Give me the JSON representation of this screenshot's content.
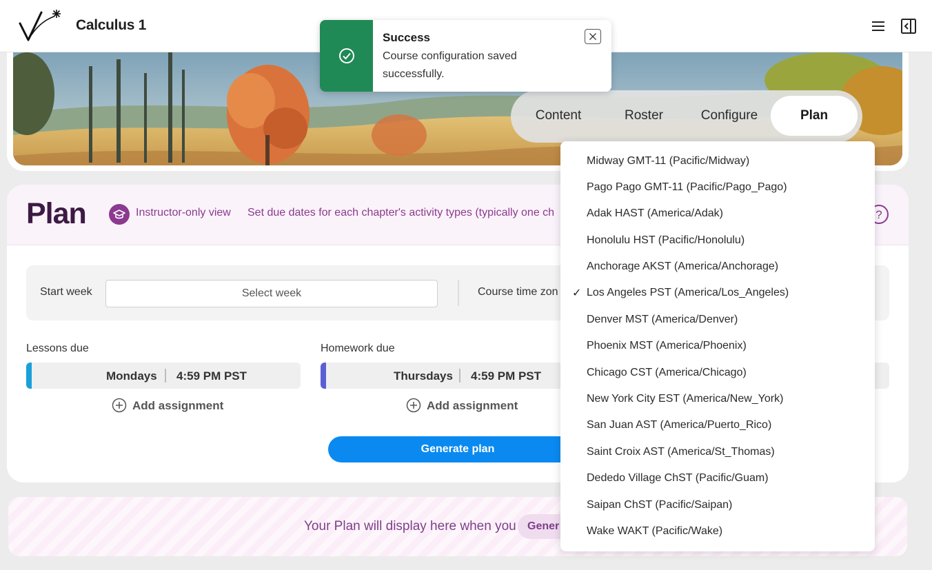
{
  "app": {
    "title": "Calculus 1"
  },
  "toast": {
    "title": "Success",
    "message": "Course configuration saved successfully."
  },
  "tabs": [
    {
      "label": "Content",
      "active": false
    },
    {
      "label": "Roster",
      "active": false
    },
    {
      "label": "Configure",
      "active": false
    },
    {
      "label": "Plan",
      "active": true
    }
  ],
  "plan": {
    "title": "Plan",
    "instructor_label": "Instructor-only view",
    "description": "Set due dates for each chapter's activity types (typically one ch",
    "start_week_label": "Start week",
    "start_week_placeholder": "Select week",
    "timezone_label": "Course time zon",
    "lessons": {
      "label": "Lessons due",
      "day": "Mondays",
      "time": "4:59 PM PST",
      "add": "Add assignment",
      "accent": "#1aa0d8"
    },
    "homework": {
      "label": "Homework due",
      "day": "Thursdays",
      "time": "4:59 PM PST",
      "add": "Add assignment",
      "accent": "#5b5fd6"
    },
    "generate_label": "Generate plan"
  },
  "placeholder": {
    "text": "Your Plan will display here when you",
    "pill": "Gener"
  },
  "timezone_options": [
    {
      "label": "Midway GMT-11 (Pacific/Midway)",
      "selected": false
    },
    {
      "label": "Pago Pago GMT-11 (Pacific/Pago_Pago)",
      "selected": false
    },
    {
      "label": "Adak HAST (America/Adak)",
      "selected": false
    },
    {
      "label": "Honolulu HST (Pacific/Honolulu)",
      "selected": false
    },
    {
      "label": "Anchorage AKST (America/Anchorage)",
      "selected": false
    },
    {
      "label": "Los Angeles PST (America/Los_Angeles)",
      "selected": true
    },
    {
      "label": "Denver MST (America/Denver)",
      "selected": false
    },
    {
      "label": "Phoenix MST (America/Phoenix)",
      "selected": false
    },
    {
      "label": "Chicago CST (America/Chicago)",
      "selected": false
    },
    {
      "label": "New York City EST (America/New_York)",
      "selected": false
    },
    {
      "label": "San Juan AST (America/Puerto_Rico)",
      "selected": false
    },
    {
      "label": "Saint Croix AST (America/St_Thomas)",
      "selected": false
    },
    {
      "label": "Dededo Village ChST (Pacific/Guam)",
      "selected": false
    },
    {
      "label": "Saipan ChST (Pacific/Saipan)",
      "selected": false
    },
    {
      "label": "Wake WAKT (Pacific/Wake)",
      "selected": false
    }
  ],
  "check_mark": "✓",
  "colors": {
    "accent_blue": "#0a8af0",
    "success_green": "#1f8a56",
    "plan_purple": "#3d1a45",
    "instructor_purple": "#8b3a8f"
  }
}
